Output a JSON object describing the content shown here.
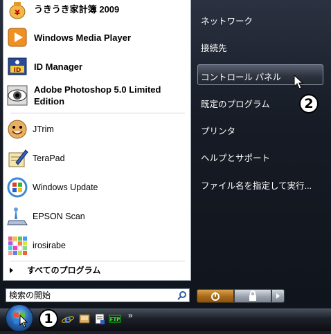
{
  "pinned": [
    {
      "label": "うきうき家計簿 2009",
      "icon": "money-bag-icon"
    },
    {
      "label": "Windows Media Player",
      "icon": "media-player-icon"
    },
    {
      "label": "ID Manager",
      "icon": "id-manager-icon"
    },
    {
      "label": "Adobe Photoshop 5.0 Limited Edition",
      "icon": "photoshop-eye-icon"
    }
  ],
  "recent": [
    {
      "label": "JTrim",
      "icon": "jtrim-icon"
    },
    {
      "label": "TeraPad",
      "icon": "terapad-icon"
    },
    {
      "label": "Windows Update",
      "icon": "windows-update-icon"
    },
    {
      "label": "EPSON Scan",
      "icon": "epson-scan-icon"
    },
    {
      "label": "irosirabe",
      "icon": "color-grid-icon"
    }
  ],
  "all_programs": "すべてのプログラム",
  "search": {
    "placeholder": "検索の開始"
  },
  "right_items": [
    "ネットワーク",
    "接続先",
    "コントロール パネル",
    "既定のプログラム",
    "プリンタ",
    "ヘルプとサポート",
    "ファイル名を指定して実行..."
  ],
  "annotations": {
    "start": "1",
    "control_panel": "2"
  },
  "taskbar": {
    "overflow": "»"
  },
  "colors": {
    "menu_dark": "#161b25",
    "power_orange": "#c0812a",
    "start_blue": "#2a6ab8"
  }
}
